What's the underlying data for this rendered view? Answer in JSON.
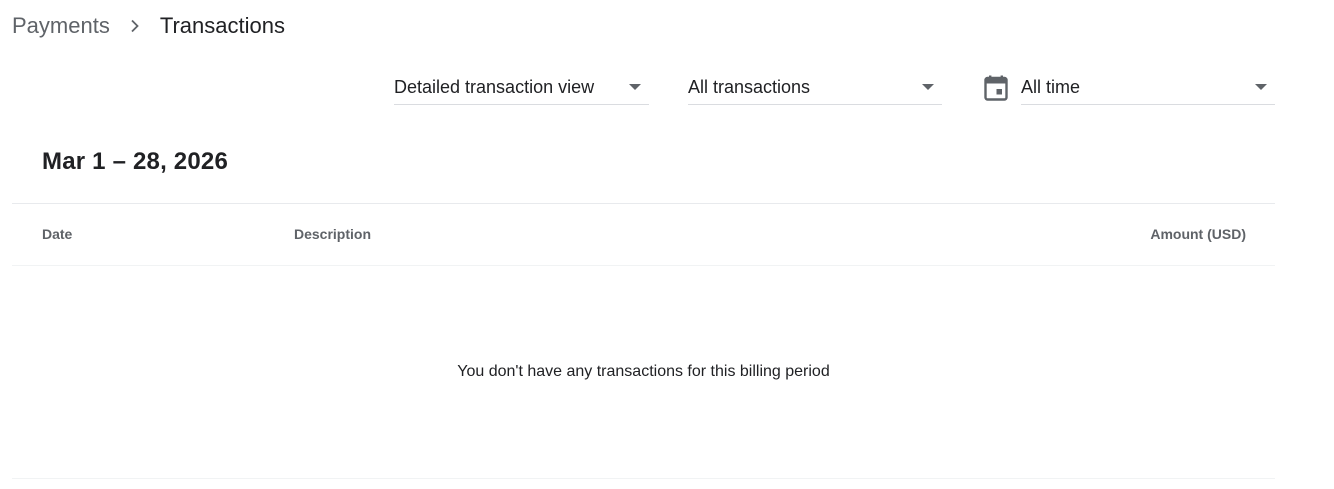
{
  "breadcrumb": {
    "parent": "Payments",
    "current": "Transactions",
    "separator_icon": "chevron-right-icon"
  },
  "filters": {
    "view": {
      "selected": "Detailed transaction view",
      "icon": "caret-down-icon"
    },
    "type": {
      "selected": "All transactions",
      "icon": "caret-down-icon"
    },
    "time": {
      "selected": "All time",
      "icon": "calendar-icon"
    }
  },
  "period": {
    "title": "Mar 1 – 28, 2026"
  },
  "table": {
    "columns": [
      "Date",
      "Description",
      "Amount (USD)"
    ],
    "rows": [],
    "empty_message": "You don't have any transactions for this billing period"
  },
  "colors": {
    "text_primary": "#202124",
    "text_secondary": "#5f6368",
    "divider": "#e8eaed"
  }
}
